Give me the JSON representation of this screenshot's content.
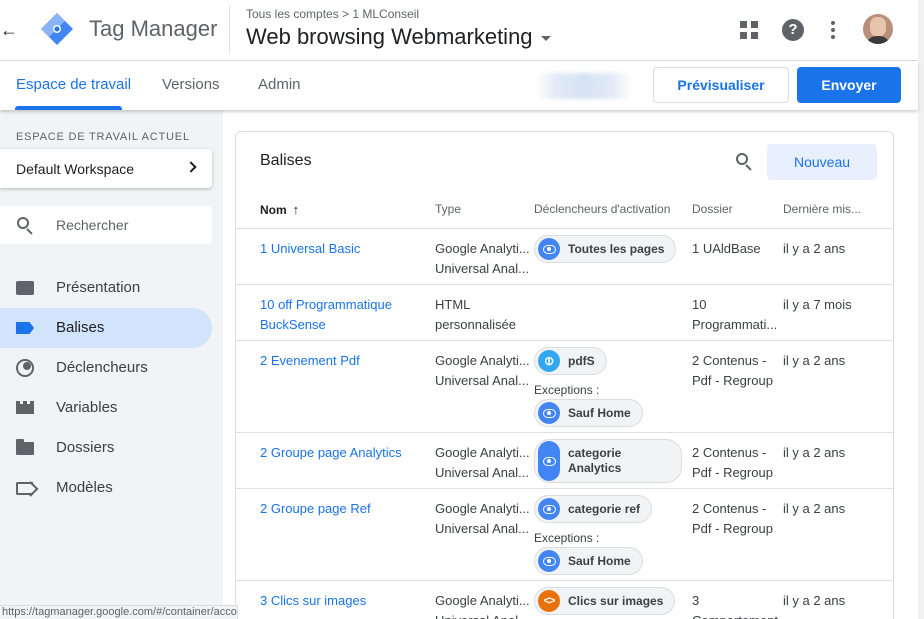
{
  "header": {
    "app_name": "Tag Manager",
    "breadcrumb": "Tous les comptes > 1 MLConseil",
    "container_name": "Web browsing Webmarketing",
    "icons": [
      "back-arrow-icon",
      "apps-grid-icon",
      "help-icon",
      "more-vert-icon"
    ]
  },
  "tabs": [
    {
      "label": "Espace de travail",
      "active": true
    },
    {
      "label": "Versions",
      "active": false
    },
    {
      "label": "Admin",
      "active": false
    }
  ],
  "actions": {
    "preview_label": "Prévisualiser",
    "submit_label": "Envoyer"
  },
  "sidebar": {
    "workspace_section_label": "ESPACE DE TRAVAIL ACTUEL",
    "workspace_name": "Default Workspace",
    "search_placeholder": "Rechercher",
    "items": [
      {
        "label": "Présentation",
        "icon": "overview-icon",
        "active": false
      },
      {
        "label": "Balises",
        "icon": "tag-icon",
        "active": true
      },
      {
        "label": "Déclencheurs",
        "icon": "trigger-icon",
        "active": false
      },
      {
        "label": "Variables",
        "icon": "variables-icon",
        "active": false
      },
      {
        "label": "Dossiers",
        "icon": "folder-icon",
        "active": false
      },
      {
        "label": "Modèles",
        "icon": "templates-icon",
        "active": false
      }
    ]
  },
  "tags_card": {
    "title": "Balises",
    "new_label": "Nouveau",
    "columns": [
      "Nom",
      "Type",
      "Déclencheurs d'activation",
      "Dossier",
      "Dernière mis..."
    ],
    "exceptions_label": "Exceptions :",
    "rows": [
      {
        "name": "1 Universal Basic",
        "type": [
          "Google Analyti...",
          "Universal Anal..."
        ],
        "triggers": [
          {
            "label": "Toutes les pages",
            "icon": "eye-icon"
          }
        ],
        "exceptions": [],
        "folder": [
          "1 UAldBase"
        ],
        "updated": "il y a 2 ans"
      },
      {
        "name": "10 off Programmatique BuckSense",
        "type": [
          "HTML",
          "personnalisée"
        ],
        "triggers": [],
        "exceptions": [],
        "folder": [
          "10",
          "Programmati..."
        ],
        "updated": "il y a 7 mois"
      },
      {
        "name": "2 Evenement Pdf",
        "type": [
          "Google Analyti...",
          "Universal Anal..."
        ],
        "triggers": [
          {
            "label": "pdfS",
            "icon": "link-icon"
          }
        ],
        "exceptions": [
          {
            "label": "Sauf Home",
            "icon": "eye-icon"
          }
        ],
        "folder": [
          "2 Contenus -",
          "Pdf - Regroup"
        ],
        "updated": "il y a 2 ans"
      },
      {
        "name": "2 Groupe page Analytics",
        "type": [
          "Google Analyti...",
          "Universal Anal..."
        ],
        "triggers": [
          {
            "label": "categorie Analytics",
            "icon": "eye-icon"
          }
        ],
        "exceptions": [],
        "folder": [
          "2 Contenus -",
          "Pdf - Regroup"
        ],
        "updated": "il y a 2 ans"
      },
      {
        "name": "2 Groupe page Ref",
        "type": [
          "Google Analyti...",
          "Universal Anal..."
        ],
        "triggers": [
          {
            "label": "categorie ref",
            "icon": "eye-icon"
          }
        ],
        "exceptions": [
          {
            "label": "Sauf Home",
            "icon": "eye-icon"
          }
        ],
        "folder": [
          "2 Contenus -",
          "Pdf - Regroup"
        ],
        "updated": "il y a 2 ans"
      },
      {
        "name": "3 Clics sur images",
        "type": [
          "Google Analyti...",
          "Universal Anal..."
        ],
        "triggers": [
          {
            "label": "Clics sur images",
            "icon": "code-icon"
          }
        ],
        "exceptions": [],
        "folder": [
          "3",
          "Comportement"
        ],
        "updated": "il y a 2 ans"
      }
    ]
  },
  "status_url": "https://tagmanager.google.com/#/container/accounts/",
  "colors": {
    "accent": "#1a73e8",
    "sidebar_bg": "#f1f3f4",
    "active_nav": "#d2e3fc"
  }
}
